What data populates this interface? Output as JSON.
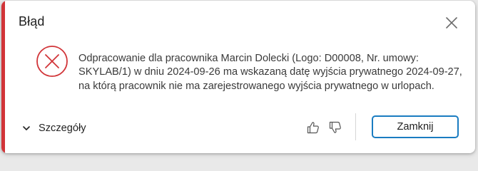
{
  "dialog": {
    "title": "Błąd",
    "message": "Odpracowanie dla pracownika Marcin Dolecki (Logo: D00008, Nr. umowy: SKYLAB/1) w dniu 2024-09-26 ma wskazaną datę wyjścia prywatnego 2024-09-27, na którą pracownik nie ma zarejestrowanego wyjścia prywatnego w urlopach.",
    "details_label": "Szczegóły",
    "close_button_label": "Zamknij",
    "icons": {
      "close": "close-icon",
      "error": "error-icon",
      "chevron": "chevron-down-icon",
      "thumbs_up": "thumbs-up-icon",
      "thumbs_down": "thumbs-down-icon"
    }
  },
  "colors": {
    "accent_error": "#d13438",
    "primary_border": "#1a7cc1",
    "background": "#e9e9e9"
  }
}
